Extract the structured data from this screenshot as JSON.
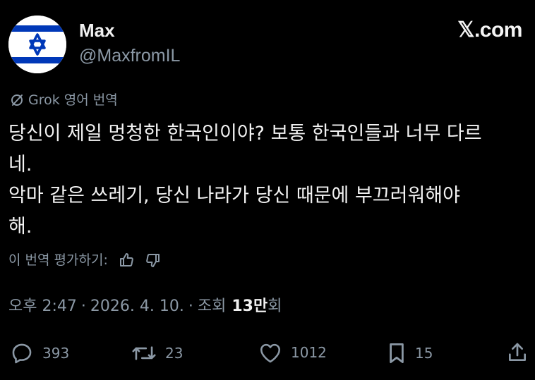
{
  "author": {
    "display_name": "Max",
    "handle": "@MaxfromIL",
    "avatar": "israel-flag-avatar"
  },
  "brand": "𝕏.com",
  "translation": {
    "label": "Grok 영어 번역",
    "icon": "translate-circle-icon"
  },
  "tweet": {
    "paragraph_1": "당신이 제일 멍청한 한국인이야? 보통 한국인들과 너무 다르\n네.",
    "paragraph_2": "악마 같은 쓰레기, 당신 나라가 당신 때문에 부끄러워해야\n해."
  },
  "rating": {
    "label": "이 번역 평가하기:"
  },
  "meta": {
    "time": "오후 2:47",
    "date": "2026. 4. 10.",
    "views_label": "조회",
    "views_number": "13만",
    "views_suffix": "회"
  },
  "actions": {
    "replies": "393",
    "reposts": "23",
    "likes": "1012",
    "bookmarks": "15"
  },
  "colors": {
    "background": "#000000",
    "text": "#e7e9ea",
    "muted": "#8b98a5",
    "flag_blue": "#0038b8"
  }
}
